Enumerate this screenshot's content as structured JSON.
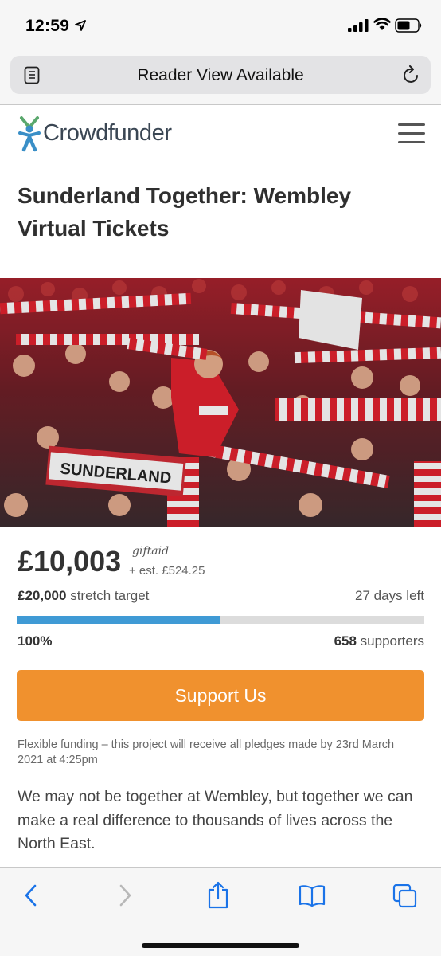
{
  "status_bar": {
    "time": "12:59"
  },
  "browser": {
    "url_bar_text": "Reader View Available"
  },
  "site": {
    "brand": "Crowdfunder"
  },
  "project": {
    "title": "Sunderland Together: Wembley Virtual Tickets",
    "hero_banner_text": "SUNDERLAND",
    "amount_raised": "£10,003",
    "giftaid_label": "giftaid",
    "giftaid_estimate": "+ est. £524.25",
    "stretch_amount": "£20,000",
    "stretch_label": "stretch target",
    "days_left": "27 days left",
    "percent_label": "100%",
    "progress_fraction": 0.5,
    "supporters_count": "658",
    "supporters_label": "supporters",
    "support_button": "Support Us",
    "funding_note": "Flexible funding – this project will receive all pledges made by 23rd March 2021 at 4:25pm",
    "description": "We may not be together at Wembley, but together we can make a real difference to thousands of lives across the North East."
  },
  "colors": {
    "accent": "#f0912e",
    "progress": "#3f9ad5",
    "brand_green": "#5aa86d",
    "brand_blue": "#3a8fc7"
  },
  "toolbar": {
    "icons": [
      "back-icon",
      "forward-icon",
      "share-icon",
      "bookmarks-icon",
      "tabs-icon"
    ]
  }
}
